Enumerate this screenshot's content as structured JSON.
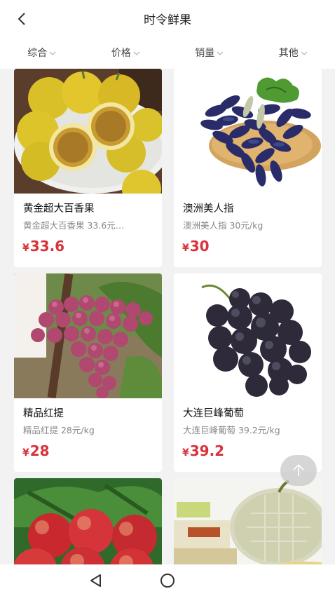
{
  "header": {
    "title": "时令鲜果"
  },
  "filters": [
    {
      "label": "综合"
    },
    {
      "label": "价格"
    },
    {
      "label": "销量"
    },
    {
      "label": "其他"
    }
  ],
  "products": [
    {
      "name": "黄金超大百香果",
      "desc": "黄金超大百香果 33.6元…",
      "currency": "¥",
      "price": "33.6",
      "image": "passion-fruit-image"
    },
    {
      "name": "澳洲美人指",
      "desc": "澳洲美人指 30元/kg",
      "currency": "¥",
      "price": "30",
      "image": "finger-grape-image"
    },
    {
      "name": "精品红提",
      "desc": "精品红提 28元/kg",
      "currency": "¥",
      "price": "28",
      "image": "red-grape-image"
    },
    {
      "name": "大连巨峰葡萄",
      "desc": "大连巨峰葡萄 39.2元/kg",
      "currency": "¥",
      "price": "39.2",
      "image": "kyoho-grape-image"
    },
    {
      "name": "",
      "desc": "",
      "currency": "",
      "price": "",
      "image": "nectarine-image"
    },
    {
      "name": "",
      "desc": "",
      "currency": "",
      "price": "",
      "image": "melon-image"
    }
  ],
  "colors": {
    "price": "#d8323a",
    "background": "#f2f2f2"
  },
  "icons": {
    "back": "chevron-left-icon",
    "dropdown": "chevron-down-icon",
    "scroll_top": "arrow-up-icon",
    "nav_back": "triangle-back-icon",
    "nav_home": "circle-home-icon"
  }
}
